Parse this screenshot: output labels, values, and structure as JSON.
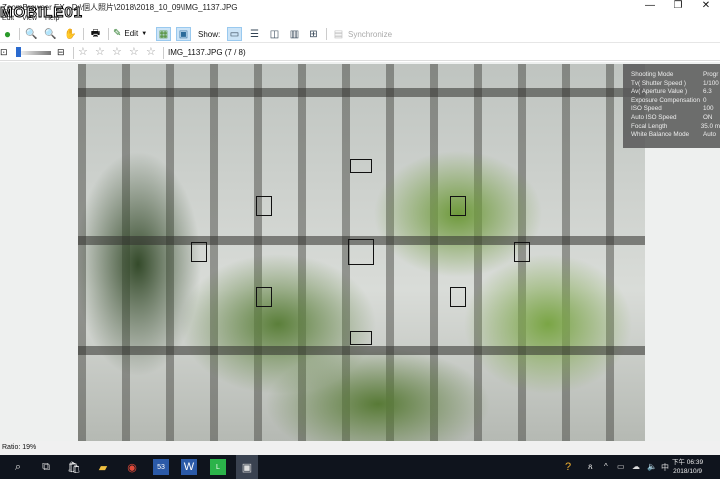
{
  "window": {
    "title": "ZoomBrowser EX - D:\\個人照片\\2018\\2018_10_09\\IMG_1137.JPG",
    "logo_text": "MOBILE01",
    "minimize": "—",
    "maximize": "❐",
    "close": "✕"
  },
  "menu": [
    "Edit",
    "View",
    "Help"
  ],
  "toolbar": {
    "edit_label": "Edit",
    "show_label": "Show:",
    "sync_label": "Synchronize"
  },
  "toolbar2": {
    "file_label": "IMG_1137.JPG (7 / 8)",
    "rating": 0,
    "stars": 5
  },
  "info_panel": [
    {
      "key": "Shooting Mode",
      "value": "Progr"
    },
    {
      "key": "Tv( Shutter Speed )",
      "value": "1/100"
    },
    {
      "key": "Av( Aperture Value )",
      "value": "6.3"
    },
    {
      "key": "Exposure Compensation",
      "value": "0"
    },
    {
      "key": "ISO Speed",
      "value": "100"
    },
    {
      "key": "Auto ISO Speed",
      "value": "ON"
    },
    {
      "key": "Focal Length",
      "value": "35.0 m"
    },
    {
      "key": "White Balance Mode",
      "value": "Auto"
    }
  ],
  "status": {
    "ratio": "Ratio: 19%"
  },
  "taskbar": {
    "badge": "53",
    "time": "下午 06:39",
    "date": "2018/10/9",
    "ime": "中"
  }
}
